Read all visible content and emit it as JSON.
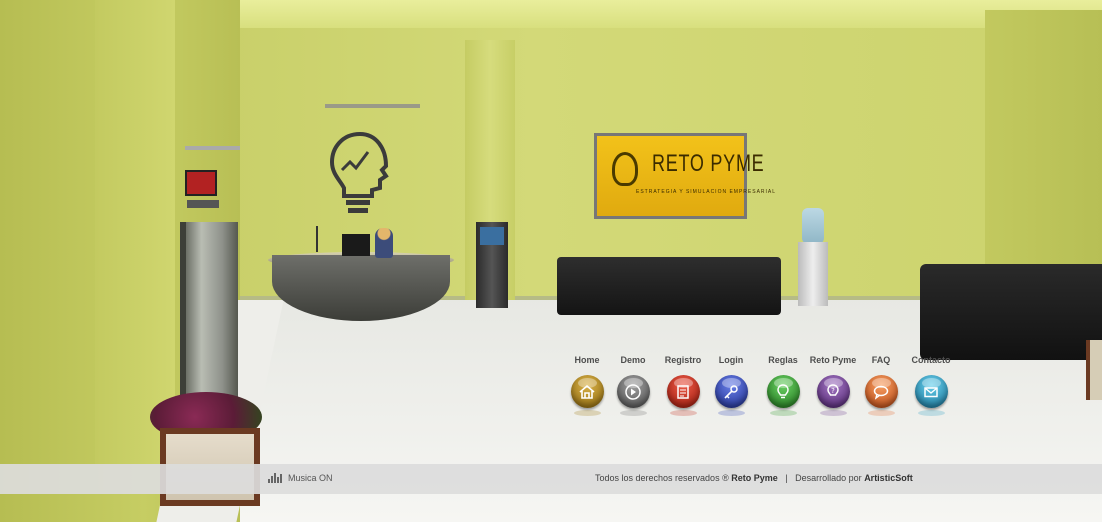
{
  "tv_sign": {
    "title": "RETO PYME",
    "subtitle": "ESTRATEGIA Y SIMULACION EMPRESARIAL"
  },
  "nav": {
    "items": [
      {
        "label": "Home",
        "icon": "home-icon",
        "color": "#a07a12"
      },
      {
        "label": "Demo",
        "icon": "play-icon",
        "color": "#6e6e6e"
      },
      {
        "label": "Registro",
        "icon": "form-icon",
        "color": "#c42a1c"
      },
      {
        "label": "Login",
        "icon": "key-icon",
        "color": "#2a42b8"
      },
      {
        "label": "Reglas",
        "icon": "bulb-icon",
        "color": "#2f9a2a"
      },
      {
        "label": "Reto Pyme",
        "icon": "question-icon",
        "color": "#6a3a8e"
      },
      {
        "label": "FAQ",
        "icon": "chat-icon",
        "color": "#e2662a"
      },
      {
        "label": "Contacto",
        "icon": "mail-icon",
        "color": "#2a9ec2"
      }
    ]
  },
  "footer": {
    "music_label": "Musica ON",
    "rights_text": "Todos los derechos reservados ®",
    "brand": "Reto Pyme",
    "separator": "|",
    "developed_text": "Desarrollado por",
    "developer": "ArtisticSoft"
  }
}
